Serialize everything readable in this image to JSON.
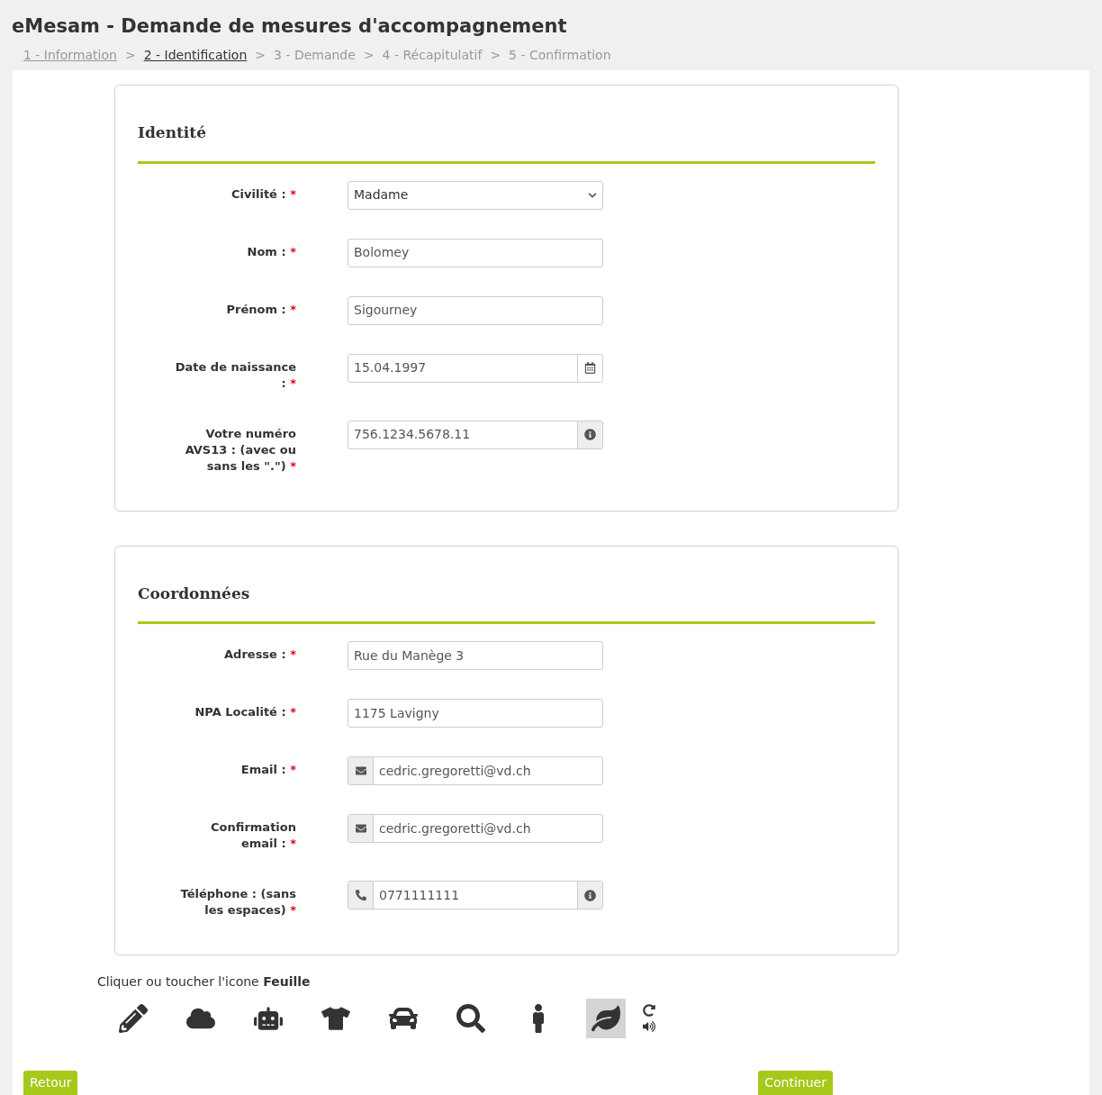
{
  "title": "eMesam - Demande de mesures d'accompagnement",
  "steps": [
    {
      "label": "1 - Information",
      "kind": "link",
      "selected": false,
      "separator": ">"
    },
    {
      "label": "2 - Identification",
      "kind": "link",
      "selected": true,
      "separator": ">"
    },
    {
      "label": "3 - Demande",
      "kind": "plain",
      "selected": false,
      "separator": ">"
    },
    {
      "label": "4 - Récapitulatif",
      "kind": "plain",
      "selected": false,
      "separator": ">"
    },
    {
      "label": "5 - Confirmation",
      "kind": "plain",
      "selected": false
    }
  ],
  "sections": [
    {
      "title": "Identité",
      "fields": [
        {
          "label": "Civilité :",
          "mark": "*",
          "kind": "select",
          "value": "Madame"
        },
        {
          "label": "Nom :",
          "mark": "*",
          "kind": "text",
          "value": "Bolomey"
        },
        {
          "label": "Prénom :",
          "mark": "*",
          "kind": "text",
          "value": "Sigourney"
        },
        {
          "label": "Date de naissance :",
          "mark": "*",
          "kind": "date",
          "value": "15.04.1997"
        },
        {
          "label": "Votre numéro AVS13 : (avec ou sans les \".\")",
          "mark": "*",
          "kind": "info",
          "value": "756.1234.5678.11"
        }
      ]
    },
    {
      "title": "Coordonnées",
      "fields": [
        {
          "label": "Adresse :",
          "mark": "*",
          "kind": "text",
          "value": "Rue du Manège 3"
        },
        {
          "label": "NPA Localité :",
          "mark": "*",
          "kind": "text",
          "value": "1175 Lavigny"
        },
        {
          "label": "Email :",
          "mark": "*",
          "kind": "email",
          "value": "cedric.gregoretti@vd.ch"
        },
        {
          "label": "Confirmation email :",
          "mark": "*",
          "kind": "email",
          "value": "cedric.gregoretti@vd.ch"
        },
        {
          "label": "Téléphone : (sans les espaces)",
          "mark": "*",
          "kind": "phone",
          "value": "0771111111"
        }
      ]
    }
  ],
  "captcha": {
    "instruction": "Cliquer ou toucher l'icone **Feuille**",
    "icons": [
      {
        "kind": "pencil",
        "selected": false
      },
      {
        "kind": "cloud",
        "selected": false
      },
      {
        "kind": "robot",
        "selected": false
      },
      {
        "kind": "tshirt",
        "selected": false
      },
      {
        "kind": "car",
        "selected": false
      },
      {
        "kind": "search",
        "selected": false
      },
      {
        "kind": "person",
        "selected": false
      },
      {
        "kind": "leaf",
        "selected": true
      }
    ]
  },
  "buttons": {
    "back": "Retour",
    "next": "Continuer"
  }
}
